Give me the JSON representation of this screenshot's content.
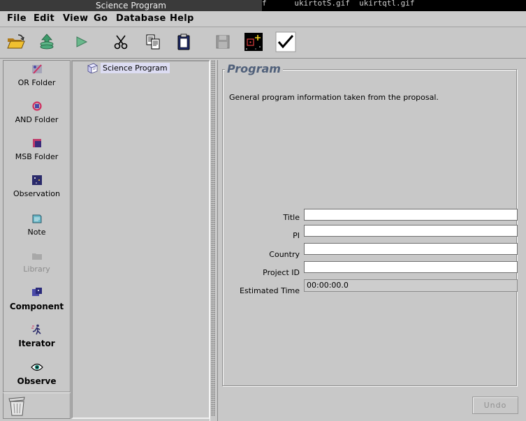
{
  "window": {
    "title": "Science Program"
  },
  "desktop": {
    "background_text": "f      ukirtotS.gif  ukirtqtl.gif"
  },
  "menubar": [
    "File",
    "Edit",
    "View",
    "Go",
    "Database",
    "Help"
  ],
  "toolbar": [
    {
      "icon": "open-folder-icon"
    },
    {
      "icon": "stack-up-icon"
    },
    {
      "icon": "arrow-right-icon"
    },
    {
      "icon": "scissors-icon"
    },
    {
      "icon": "copy-icon"
    },
    {
      "icon": "paste-icon"
    },
    {
      "icon": "save-disk-icon"
    },
    {
      "icon": "target-add-icon"
    },
    {
      "icon": "checkmark-icon"
    }
  ],
  "palette": [
    {
      "label": "OR Folder",
      "icon": "or-folder-icon"
    },
    {
      "label": "AND Folder",
      "icon": "and-folder-icon"
    },
    {
      "label": "MSB Folder",
      "icon": "msb-folder-icon"
    },
    {
      "label": "Observation",
      "icon": "observation-icon"
    },
    {
      "label": "Note",
      "icon": "note-icon"
    },
    {
      "label": "Library",
      "icon": "library-icon",
      "disabled": true
    },
    {
      "label": "Component",
      "icon": "component-icon"
    },
    {
      "label": "Iterator",
      "icon": "iterator-icon"
    },
    {
      "label": "Observe",
      "icon": "eye-icon"
    }
  ],
  "tree": {
    "root_label": "Science Program"
  },
  "editor": {
    "group_title": "Program",
    "description": "General program information taken from the proposal.",
    "fields": {
      "title": {
        "label": "Title",
        "value": ""
      },
      "pi": {
        "label": "PI",
        "value": ""
      },
      "country": {
        "label": "Country",
        "value": ""
      },
      "project_id": {
        "label": "Project ID",
        "value": ""
      },
      "estimated_time": {
        "label": "Estimated Time",
        "value": "00:00:00.0"
      }
    },
    "undo_label": "Undo"
  },
  "colors": {
    "panel_bg": "#c8c8c8",
    "group_title": "#50607a",
    "tree_selection": "#dcdcf2",
    "titlebar": "#3a3a3a"
  }
}
